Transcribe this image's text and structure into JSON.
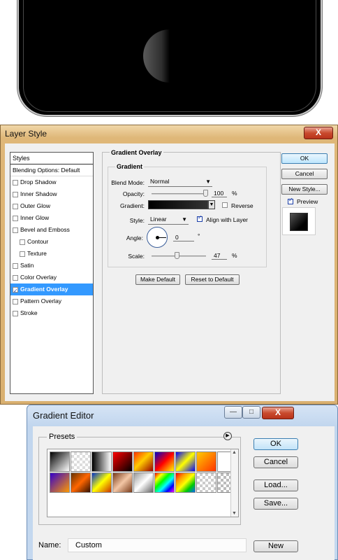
{
  "layer_style": {
    "title": "Layer Style",
    "close_label": "X",
    "styles_header": "Styles",
    "items": [
      {
        "label": "Blending Options: Default",
        "checkbox": false,
        "checked": false,
        "sub": false,
        "selected": false
      },
      {
        "label": "Drop Shadow",
        "checkbox": true,
        "checked": false,
        "sub": false,
        "selected": false
      },
      {
        "label": "Inner Shadow",
        "checkbox": true,
        "checked": false,
        "sub": false,
        "selected": false
      },
      {
        "label": "Outer Glow",
        "checkbox": true,
        "checked": false,
        "sub": false,
        "selected": false
      },
      {
        "label": "Inner Glow",
        "checkbox": true,
        "checked": false,
        "sub": false,
        "selected": false
      },
      {
        "label": "Bevel and Emboss",
        "checkbox": true,
        "checked": false,
        "sub": false,
        "selected": false
      },
      {
        "label": "Contour",
        "checkbox": true,
        "checked": false,
        "sub": true,
        "selected": false
      },
      {
        "label": "Texture",
        "checkbox": true,
        "checked": false,
        "sub": true,
        "selected": false
      },
      {
        "label": "Satin",
        "checkbox": true,
        "checked": false,
        "sub": false,
        "selected": false
      },
      {
        "label": "Color Overlay",
        "checkbox": true,
        "checked": false,
        "sub": false,
        "selected": false
      },
      {
        "label": "Gradient Overlay",
        "checkbox": true,
        "checked": true,
        "sub": false,
        "selected": true
      },
      {
        "label": "Pattern Overlay",
        "checkbox": true,
        "checked": false,
        "sub": false,
        "selected": false
      },
      {
        "label": "Stroke",
        "checkbox": true,
        "checked": false,
        "sub": false,
        "selected": false
      }
    ],
    "panel_title": "Gradient Overlay",
    "group_title": "Gradient",
    "blend_mode_label": "Blend Mode:",
    "blend_mode_value": "Normal",
    "opacity_label": "Opacity:",
    "opacity_value": "100",
    "opacity_fraction": 1.0,
    "percent": "%",
    "gradient_label": "Gradient:",
    "reverse_label": "Reverse",
    "reverse_checked": false,
    "style_label": "Style:",
    "style_value": "Linear",
    "align_label": "Align with Layer",
    "align_checked": true,
    "angle_label": "Angle:",
    "angle_value": "0",
    "degree": "°",
    "scale_label": "Scale:",
    "scale_value": "47",
    "scale_fraction": 0.47,
    "make_default": "Make Default",
    "reset_default": "Reset to Default",
    "ok": "OK",
    "cancel": "Cancel",
    "new_style": "New Style...",
    "preview_label": "Preview",
    "preview_checked": true
  },
  "gradient_editor": {
    "title": "Gradient Editor",
    "presets_label": "Presets",
    "ok": "OK",
    "cancel": "Cancel",
    "load": "Load...",
    "save": "Save...",
    "name_label": "Name:",
    "name_value": "Custom",
    "new": "New",
    "presets": [
      "linear-gradient(135deg,#000 0%,#fff 100%)",
      "repeating-conic-gradient(#ddd 0% 25%, #fff 0% 50%) 0 0/8px 8px",
      "linear-gradient(90deg,#000 0%,#fff 100%)",
      "linear-gradient(135deg,#ff0000 0%,#000 100%)",
      "linear-gradient(135deg,#ff3300 0%,#ffcc00 45%,#990000 100%)",
      "linear-gradient(135deg,#0000cc 0%,#ff0000 50%,#ffff00 100%)",
      "linear-gradient(135deg,#0000ff 0%,#ffff00 50%,#0000ff 100%)",
      "linear-gradient(135deg,#ffcc00 0%,#ff3300 100%)",
      "linear-gradient(135deg,#ffffff 0%,#ffffff 100%)",
      "linear-gradient(135deg,#3300cc 0%,#ff9900 100%)",
      "linear-gradient(135deg,#663300 0%,#ff6600 50%,#331100 100%)",
      "linear-gradient(135deg,#0033cc 0%,#ffff00 50%,#cc3300 100%)",
      "linear-gradient(135deg,#7a3b1a 0%,#f3c6a5 50%,#7a3b1a 100%)",
      "linear-gradient(135deg,#999 0%,#fff 50%,#666 100%)",
      "linear-gradient(135deg,#ff0000,#ffff00,#00ff00,#00ffff,#0000ff,#ff00ff)",
      "linear-gradient(135deg,#ff0000 0%,#ff9900 25%,#ffff00 50%,#00cc00 75%,#0066ff 100%)",
      "repeating-conic-gradient(#ccc 0% 25%, #fff 0% 50%) 0 0/8px 8px",
      "repeating-conic-gradient(#bbb 0% 25%, #fff 0% 50%) 0 0/8px 8px"
    ]
  }
}
